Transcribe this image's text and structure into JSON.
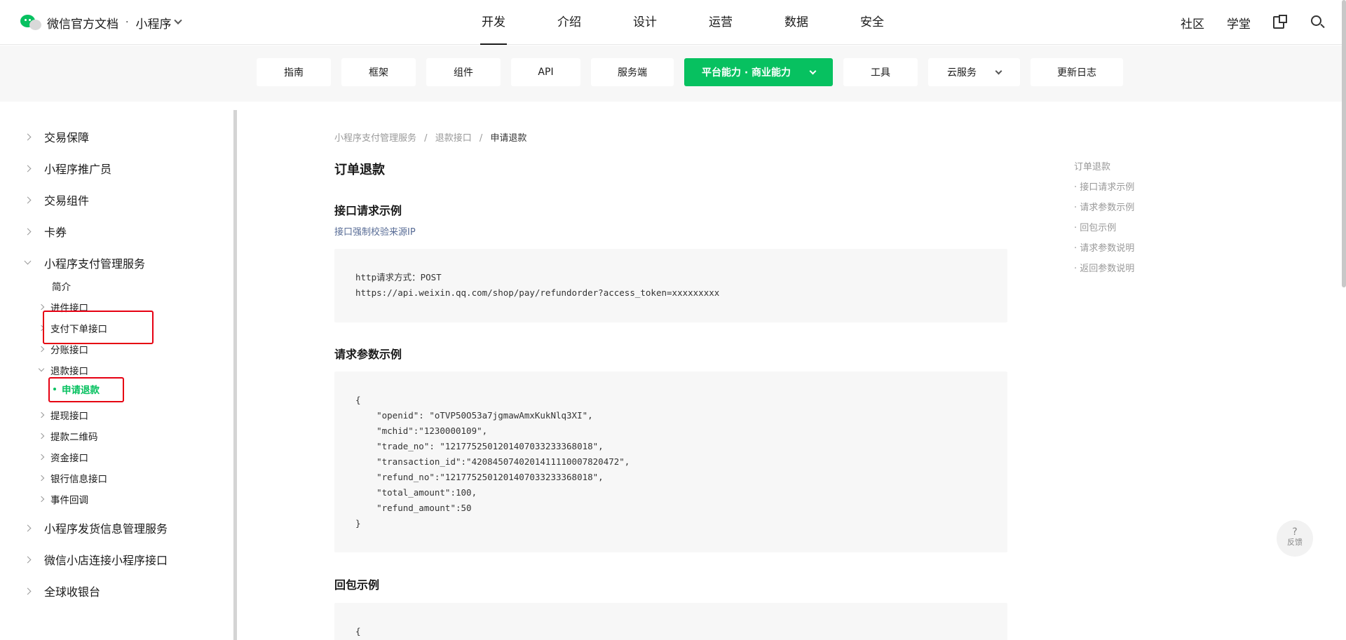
{
  "header": {
    "brand_title": "微信官方文档",
    "brand_sep": "·",
    "brand_sub": "小程序",
    "nav": [
      {
        "label": "开发",
        "active": true
      },
      {
        "label": "介绍"
      },
      {
        "label": "设计"
      },
      {
        "label": "运营"
      },
      {
        "label": "数据"
      },
      {
        "label": "安全"
      }
    ],
    "right_links": [
      "社区",
      "学堂"
    ],
    "icons": [
      "docs-switch-icon",
      "search-icon"
    ]
  },
  "subnav": [
    {
      "label": "指南"
    },
    {
      "label": "框架"
    },
    {
      "label": "组件"
    },
    {
      "label": "API"
    },
    {
      "label": "服务端"
    },
    {
      "label": "平台能力 · 商业能力",
      "active": true
    },
    {
      "label": "工具"
    },
    {
      "label": "云服务"
    },
    {
      "label": "更新日志"
    }
  ],
  "sidebar": {
    "items": [
      {
        "label": "交易保障"
      },
      {
        "label": "小程序推广员"
      },
      {
        "label": "交易组件"
      },
      {
        "label": "卡券"
      },
      {
        "label": "小程序支付管理服务"
      },
      {
        "label": "简介"
      },
      {
        "label": "进件接口"
      },
      {
        "label": "支付下单接口"
      },
      {
        "label": "分账接口"
      },
      {
        "label": "退款接口"
      },
      {
        "label": "申请退款"
      },
      {
        "label": "提现接口"
      },
      {
        "label": "提款二维码"
      },
      {
        "label": "资金接口"
      },
      {
        "label": "银行信息接口"
      },
      {
        "label": "事件回调"
      },
      {
        "label": "小程序发货信息管理服务"
      },
      {
        "label": "微信小店连接小程序接口"
      },
      {
        "label": "全球收银台"
      }
    ]
  },
  "content": {
    "breadcrumb": [
      "小程序支付管理服务",
      "退款接口",
      "申请退款"
    ],
    "breadcrumb_sep": "/",
    "title": "订单退款",
    "section1": "接口请求示例",
    "link1": "接口强制校验来源IP",
    "code1": "http请求方式：POST\nhttps://api.weixin.qq.com/shop/pay/refundorder?access_token=xxxxxxxxx",
    "section2": "请求参数示例",
    "code2": "{\n    \"openid\": \"oTVP50O53a7jgmawAmxKukNlq3XI\",\n    \"mchid\":\"1230000109\",\n    \"trade_no\": \"1217752501201407033233368018\",\n    \"transaction_id\":\"4208450740201411110007820472\",\n    \"refund_no\":\"1217752501201407033233368018\",\n    \"total_amount\":100,\n    \"refund_amount\":50\n}",
    "section3": "回包示例",
    "code3": "{"
  },
  "toc": {
    "items": [
      "订单退款",
      "· 接口请求示例",
      "· 请求参数示例",
      "· 回包示例",
      "· 请求参数说明",
      "· 返回参数说明"
    ]
  },
  "feedback": {
    "symbol": "?",
    "label": "反馈"
  },
  "colors": {
    "accent": "#07c160",
    "highlight_box": "#e60012",
    "link": "#576b95"
  }
}
